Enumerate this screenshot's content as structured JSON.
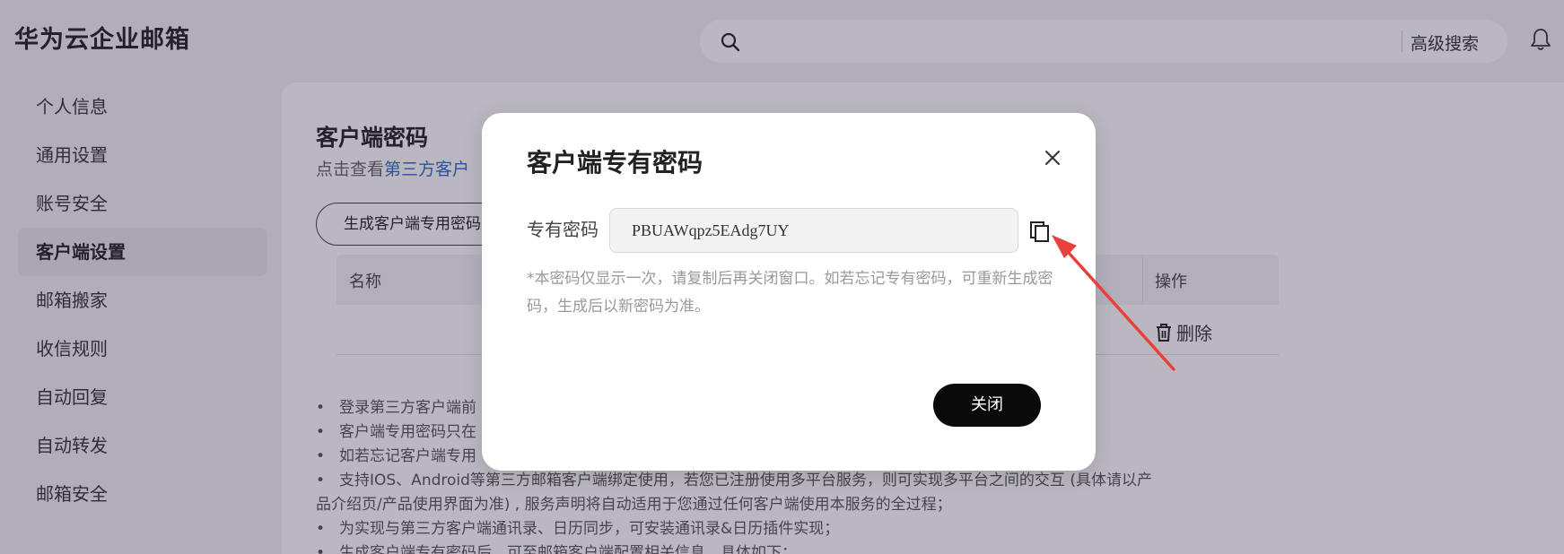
{
  "header": {
    "app_title": "华为云企业邮箱",
    "search_placeholder": "",
    "advanced_search_label": "高级搜索"
  },
  "sidebar": {
    "items": [
      {
        "label": "个人信息",
        "active": false
      },
      {
        "label": "通用设置",
        "active": false
      },
      {
        "label": "账号安全",
        "active": false
      },
      {
        "label": "客户端设置",
        "active": true
      },
      {
        "label": "邮箱搬家",
        "active": false
      },
      {
        "label": "收信规则",
        "active": false
      },
      {
        "label": "自动回复",
        "active": false
      },
      {
        "label": "自动转发",
        "active": false
      },
      {
        "label": "邮箱安全",
        "active": false
      }
    ]
  },
  "main": {
    "title": "客户端密码",
    "desc_prefix": "点击查看",
    "desc_link": "第三方客户",
    "generate_button": "生成客户端专用密码",
    "table": {
      "col_name": "名称",
      "col_action": "操作",
      "row_delete": "删除"
    },
    "notes": [
      "登录第三方客户端前",
      "客户端专用密码只在",
      "如若忘记客户端专用",
      "支持IOS、Android等第三方邮箱客户端绑定使用，若您已注册使用多平台服务，则可实现多平台之间的交互 (具体请以产",
      "品介绍页/产品使用界面为准) , 服务声明将自动适用于您通过任何客户端使用本服务的全过程；",
      "为实现与第三方客户端通讯录、日历同步，可安装通讯录&日历插件实现；",
      "生成客户端专有密码后，可至邮箱客户端配置相关信息，具体如下："
    ]
  },
  "dialog": {
    "title": "客户端专有密码",
    "password_label": "专有密码",
    "password_value": "PBUAWqpz5EAdg7UY",
    "hint": "*本密码仅显示一次，请复制后再关闭窗口。如若忘记专有密码，可重新生成密码，生成后以新密码为准。",
    "close_button": "关闭"
  },
  "colors": {
    "link": "#2f6bd7",
    "primary_button": "#0a0a0a",
    "annotation_arrow": "#e8413c"
  }
}
